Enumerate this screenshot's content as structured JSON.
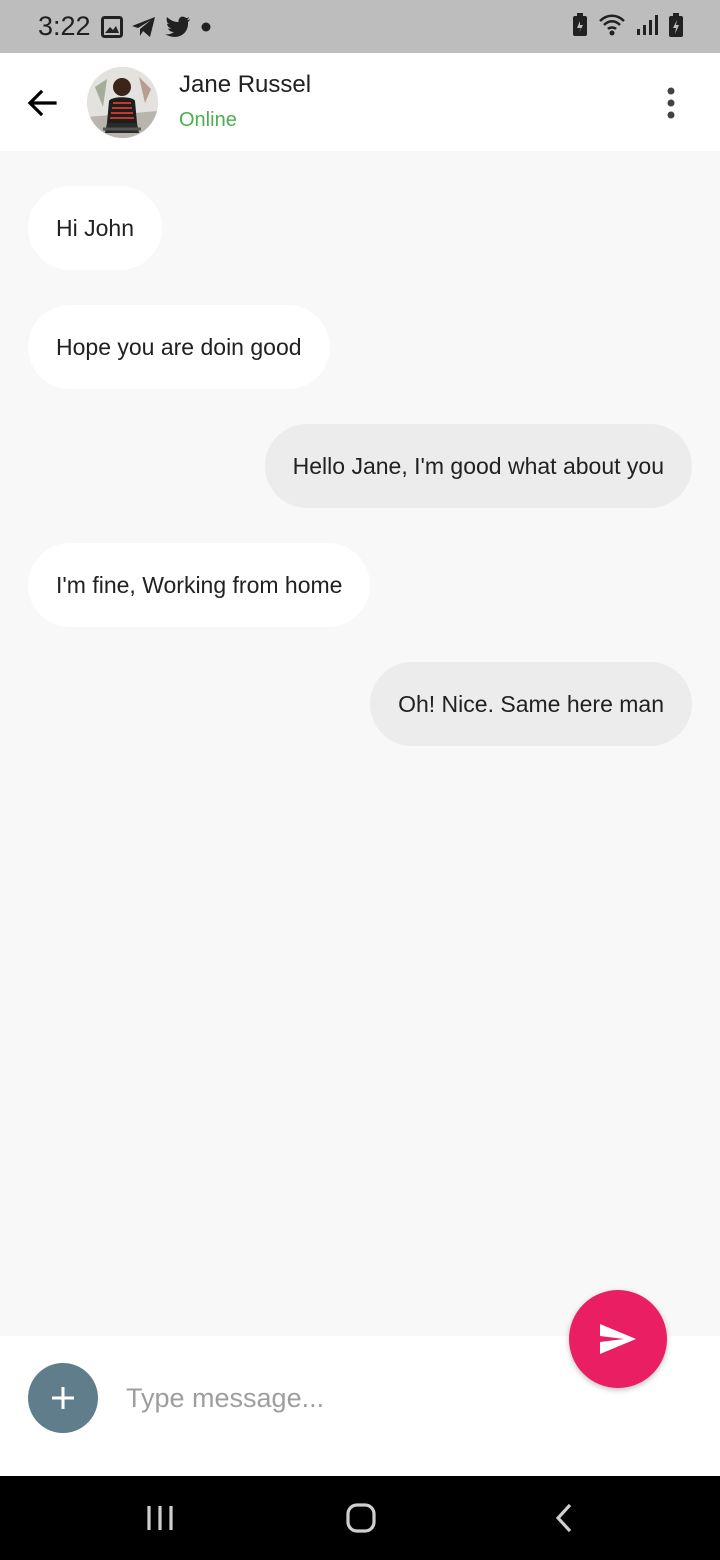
{
  "status_bar": {
    "time": "3:22",
    "left_icons": [
      "gallery-icon",
      "telegram-icon",
      "twitter-icon",
      "dot-icon"
    ],
    "right_icons": [
      "battery-saver-icon",
      "wifi-icon",
      "signal-icon",
      "battery-charging-icon"
    ]
  },
  "header": {
    "contact_name": "Jane Russel",
    "status": "Online",
    "status_color": "#4caf50",
    "back_icon": "arrow-back-icon",
    "menu_icon": "more-vert-icon"
  },
  "messages": [
    {
      "text": "Hi John",
      "direction": "incoming"
    },
    {
      "text": "Hope you are doin good",
      "direction": "incoming"
    },
    {
      "text": "Hello Jane, I'm good what about you",
      "direction": "outgoing"
    },
    {
      "text": "I'm fine, Working from home",
      "direction": "incoming"
    },
    {
      "text": "Oh! Nice. Same here man",
      "direction": "outgoing"
    }
  ],
  "composer": {
    "placeholder": "Type message...",
    "value": "",
    "add_icon": "plus-icon",
    "send_icon": "send-icon",
    "send_color": "#e91e63",
    "add_color": "#607d8b"
  },
  "nav_bar": {
    "icons": [
      "recent-apps-icon",
      "home-icon",
      "back-icon"
    ]
  }
}
